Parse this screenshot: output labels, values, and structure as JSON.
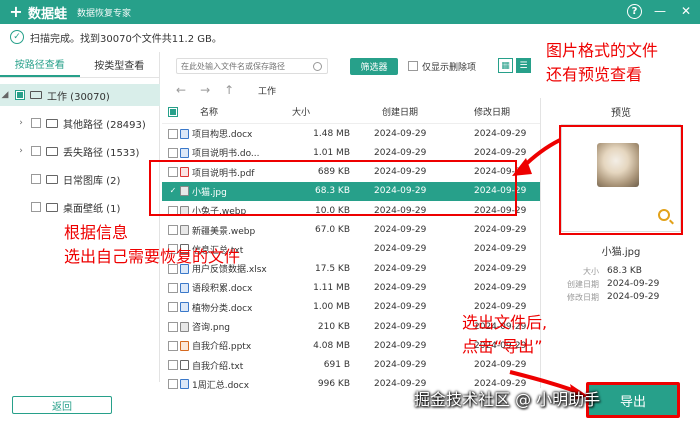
{
  "title_bar": {
    "logo_mark": "+",
    "app_name": "数据蛙",
    "subtitle": "数据恢复专家",
    "help": "?",
    "minimize": "—",
    "close": "✕"
  },
  "status": {
    "text": "扫描完成。找到30070个文件共11.2 GB。"
  },
  "left_tabs": [
    {
      "label": "按路径查看",
      "active": true
    },
    {
      "label": "按类型查看",
      "active": false
    }
  ],
  "tree": [
    {
      "label": "工作 (30070)"
    },
    {
      "label": "其他路径 (28493)"
    },
    {
      "label": "丢失路径 (1533)"
    },
    {
      "label": "日常图库 (2)"
    },
    {
      "label": "桌面壁纸 (1)"
    }
  ],
  "toolbar": {
    "search_placeholder": "在此处输入文件名或保存路径",
    "filter_label": "筛选器",
    "deleted_only_label": "仅显示删除项"
  },
  "nav": {
    "back": "←",
    "forward": "→",
    "up": "↑",
    "path": "工作"
  },
  "table": {
    "columns": [
      "名称",
      "大小",
      "创建日期",
      "修改日期"
    ],
    "rows": [
      {
        "name": "项目构思.docx",
        "size": "1.48 MB",
        "created": "2024-09-29",
        "modified": "2024-09-29",
        "type": "docx",
        "selected": false
      },
      {
        "name": "项目说明书.do...",
        "size": "1.01 MB",
        "created": "2024-09-29",
        "modified": "2024-09-29",
        "type": "docx",
        "selected": false
      },
      {
        "name": "项目说明书.pdf",
        "size": "689 KB",
        "created": "2024-09-29",
        "modified": "2024-09-2",
        "type": "pdf",
        "selected": false
      },
      {
        "name": "小猫.jpg",
        "size": "68.3 KB",
        "created": "2024-09-29",
        "modified": "2024-09-29",
        "type": "img",
        "selected": true
      },
      {
        "name": "小兔子.webp",
        "size": "10.0 KB",
        "created": "2024-09-29",
        "modified": "2024-09-29",
        "type": "img",
        "selected": false
      },
      {
        "name": "新疆美景.webp",
        "size": "67.0 KB",
        "created": "2024-09-29",
        "modified": "2024-09-29",
        "type": "img",
        "selected": false
      },
      {
        "name": "信息汇总.txt",
        "size": "",
        "created": "2024-09-29",
        "modified": "2024-09-29",
        "type": "txt",
        "selected": false
      },
      {
        "name": "用户反馈数据.xlsx",
        "size": "17.5 KB",
        "created": "2024-09-29",
        "modified": "2024-09-29",
        "type": "docx",
        "selected": false
      },
      {
        "name": "语段积累.docx",
        "size": "1.11 MB",
        "created": "2024-09-29",
        "modified": "2024-09-29",
        "type": "docx",
        "selected": false
      },
      {
        "name": "植物分类.docx",
        "size": "1.00 MB",
        "created": "2024-09-29",
        "modified": "2024-09-29",
        "type": "docx",
        "selected": false
      },
      {
        "name": "咨询.png",
        "size": "210 KB",
        "created": "2024-09-29",
        "modified": "2024-09-29",
        "type": "img",
        "selected": false
      },
      {
        "name": "自我介绍.pptx",
        "size": "4.08 MB",
        "created": "2024-09-29",
        "modified": "2024-09-29",
        "type": "pptx",
        "selected": false
      },
      {
        "name": "自我介绍.txt",
        "size": "691 B",
        "created": "2024-09-29",
        "modified": "2024-09-29",
        "type": "txt",
        "selected": false
      },
      {
        "name": "1周汇总.docx",
        "size": "996 KB",
        "created": "2024-09-29",
        "modified": "2024-09-29",
        "type": "docx",
        "selected": false
      }
    ]
  },
  "preview": {
    "title": "预览",
    "file_name": "小猫.jpg",
    "meta": [
      {
        "key": "大小",
        "value": "68.3 KB"
      },
      {
        "key": "创建日期",
        "value": "2024-09-29"
      },
      {
        "key": "修改日期",
        "value": "2024-09-29"
      }
    ]
  },
  "bottom": {
    "back_label": "返回",
    "export_label": "导出"
  },
  "annotations": {
    "preview_note_1": "图片格式的文件",
    "preview_note_2": "还有预览查看",
    "select_note_1": "根据信息",
    "select_note_2": "选出自己需要恢复的文件",
    "export_note_1": "选出文件后,",
    "export_note_2": "点击“导出”"
  },
  "watermark": "掘金技术社区 @ 小明助手",
  "colors": {
    "accent": "#27a08a",
    "annotation": "#e00000"
  }
}
